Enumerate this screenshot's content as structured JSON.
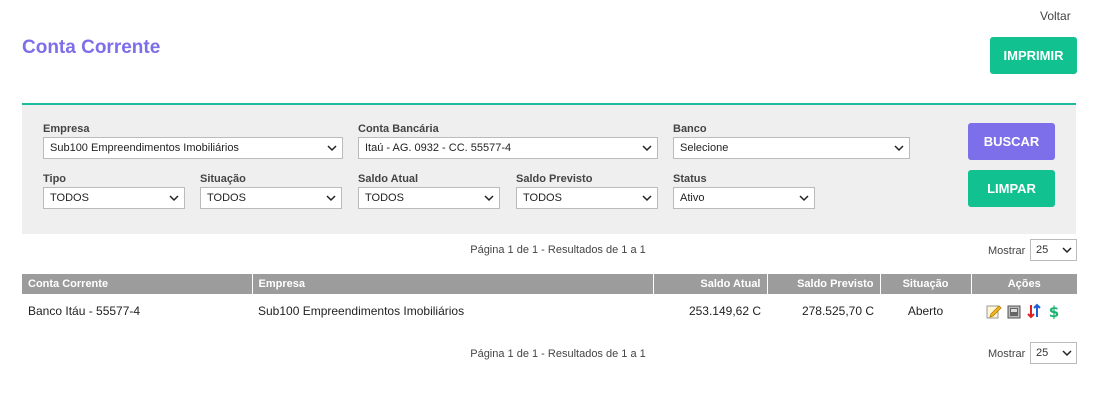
{
  "header": {
    "back_label": "Voltar",
    "title": "Conta Corrente",
    "print_label": "IMPRIMIR"
  },
  "filters": {
    "empresa": {
      "label": "Empresa",
      "value": "Sub100 Empreendimentos Imobiliários"
    },
    "conta_bancaria": {
      "label": "Conta Bancária",
      "value": "Itaú - AG. 0932 - CC. 55577-4"
    },
    "banco": {
      "label": "Banco",
      "value": "Selecione"
    },
    "tipo": {
      "label": "Tipo",
      "value": "TODOS"
    },
    "situacao": {
      "label": "Situação",
      "value": "TODOS"
    },
    "saldo_atual": {
      "label": "Saldo Atual",
      "value": "TODOS"
    },
    "saldo_previsto": {
      "label": "Saldo Previsto",
      "value": "TODOS"
    },
    "status": {
      "label": "Status",
      "value": "Ativo"
    },
    "search_label": "BUSCAR",
    "clear_label": "LIMPAR"
  },
  "pagination": {
    "text": "Página 1 de 1 - Resultados de 1 a 1",
    "per_page_label": "Mostrar",
    "per_page_value": "25"
  },
  "table": {
    "columns": [
      "Conta Corrente",
      "Empresa",
      "Saldo Atual",
      "Saldo Previsto",
      "Situação",
      "Ações"
    ],
    "rows": [
      {
        "conta": "Banco Itáu - 55577-4",
        "empresa": "Sub100 Empreendimentos Imobiliários",
        "saldo_atual": "253.149,62 C",
        "saldo_previsto": "278.525,70 C",
        "situacao": "Aberto",
        "actions": [
          "edit-icon",
          "archive-icon",
          "transfer-icon",
          "money-icon"
        ]
      }
    ]
  },
  "colors": {
    "accent_purple": "#7d6ee9",
    "accent_green": "#11c18f",
    "header_gray": "#9c9c9c",
    "panel_bg": "#efefef"
  }
}
